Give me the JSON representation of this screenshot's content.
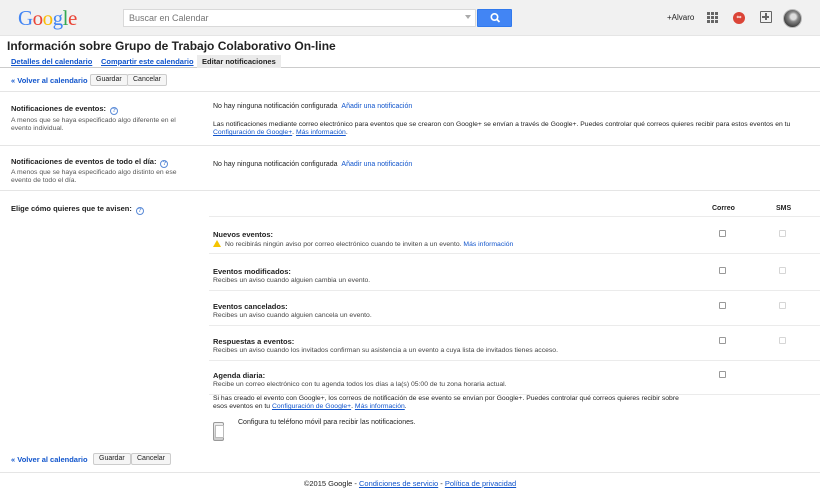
{
  "header": {
    "logo_letters": [
      {
        "ch": "G",
        "color": "#4285f4"
      },
      {
        "ch": "o",
        "color": "#ea4335"
      },
      {
        "ch": "o",
        "color": "#fbbc05"
      },
      {
        "ch": "g",
        "color": "#4285f4"
      },
      {
        "ch": "l",
        "color": "#34a853"
      },
      {
        "ch": "e",
        "color": "#ea4335"
      }
    ],
    "search_placeholder": "Buscar en Calendar",
    "user": "+Alvaro",
    "notif_icon": "infinity-icon",
    "notif_text": "∞"
  },
  "page_title": "Información sobre Grupo de Trabajo Colaborativo On-line",
  "tabs": {
    "details": "Detalles del calendario",
    "share": "Compartir este calendario",
    "notifications": "Editar notificaciones"
  },
  "toolbar": {
    "back": "« Volver al calendario",
    "save": "Guardar",
    "cancel": "Cancelar"
  },
  "event_notifications": {
    "label": "Notificaciones de eventos:",
    "sub": "A menos que se haya especificado algo diferente en el evento individual.",
    "status": "No hay ninguna notificación configurada",
    "add": "Añadir una notificación",
    "info_pre": "Las notificaciones mediante correo electrónico para eventos que se crearon con Google+ se envían a través de Google+. Puedes controlar qué correos quieres recibir para estos eventos en tu ",
    "info_link": "Configuración de Google+",
    "info_mid": ". ",
    "info_more": "Más información",
    "info_end": "."
  },
  "allday_notifications": {
    "label": "Notificaciones de eventos de todo el día:",
    "sub": "A menos que se haya especificado algo distinto en ese evento de todo el día.",
    "status": "No hay ninguna notificación configurada",
    "add": "Añadir una notificación"
  },
  "choose": {
    "label": "Elige cómo quieres que te avisen:",
    "col_email": "Correo",
    "col_sms": "SMS",
    "rows": [
      {
        "title": "Nuevos eventos:",
        "desc": "No recibirás ningún aviso por correo electrónico cuando te inviten a un evento.",
        "more": "Más información",
        "warn": true
      },
      {
        "title": "Eventos modificados:",
        "desc": "Recibes un aviso cuando alguien cambia un evento.",
        "more": "",
        "warn": false
      },
      {
        "title": "Eventos cancelados:",
        "desc": "Recibes un aviso cuando alguien cancela un evento.",
        "more": "",
        "warn": false
      },
      {
        "title": "Respuestas a eventos:",
        "desc": "Recibes un aviso cuando los invitados confirman su asistencia a un evento a cuya lista de invitados tienes acceso.",
        "more": "",
        "warn": false
      },
      {
        "title": "Agenda diaria:",
        "desc": "Recibe un correo electrónico con tu agenda todos los días a la(s) 05:00 de tu zona horaria actual.",
        "more": "",
        "warn": false
      }
    ],
    "gplus_pre": "Si has creado el evento con Google+, los correos de notificación de ese evento se envían por Google+. Puedes controlar qué correos quieres recibir sobre esos eventos en tu ",
    "gplus_link": "Configuración de Google+",
    "gplus_mid": ". ",
    "gplus_more": "Más información",
    "gplus_end": ".",
    "mobile_link": "Configura tu teléfono móvil para recibir las notificaciones."
  },
  "footer": {
    "copyright": "©2015 Google - ",
    "terms": "Condiciones de servicio",
    "dash": " - ",
    "privacy": "Política de privacidad"
  }
}
